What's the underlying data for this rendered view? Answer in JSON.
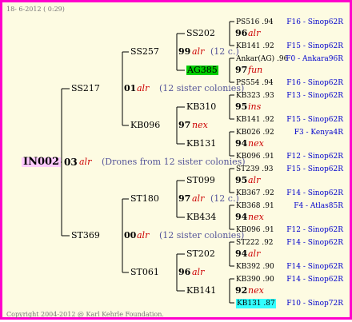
{
  "header": {
    "date": "18-  6-2012 ( 0:29)"
  },
  "footer": {
    "copyright": "Copyright 2004-2012 @ Karl Kehrle Foundation."
  },
  "root": {
    "id": "IN002",
    "num": "03",
    "mark": "alr",
    "note": "(Drones from 12 sister colonies)"
  },
  "gen1": [
    {
      "id": "SS217",
      "num": "01",
      "mark": "alr",
      "note": "(12 sister colonies)"
    },
    {
      "id": "ST369",
      "num": "00",
      "mark": "alr",
      "note": "(12 sister colonies)"
    }
  ],
  "gen2": [
    {
      "id": "SS257",
      "num": "99",
      "mark": "alr",
      "note": "(12 c.)"
    },
    {
      "id": "KB096",
      "num": "97",
      "mark": "nex"
    },
    {
      "id": "ST180",
      "num": "97",
      "mark": "alr",
      "note": "(12 c.)"
    },
    {
      "id": "ST061",
      "num": "96",
      "mark": "alr"
    }
  ],
  "gen3": [
    {
      "id": "SS202",
      "num": "96",
      "mark": "alr"
    },
    {
      "id": "AG385",
      "num": "97",
      "mark": "fun"
    },
    {
      "id": "KB310",
      "num": "95",
      "mark": "ins"
    },
    {
      "id": "KB131",
      "num": "94",
      "mark": "nex"
    },
    {
      "id": "ST099",
      "num": "95",
      "mark": "alr"
    },
    {
      "id": "KB434",
      "num": "94",
      "mark": "nex"
    },
    {
      "id": "ST202",
      "num": "94",
      "mark": "alr"
    },
    {
      "id": "KB141",
      "num": "92",
      "mark": "nex"
    }
  ],
  "gen4": [
    {
      "name": "PS516 .94",
      "origin": "F16 - Sinop62R"
    },
    {
      "name": "KB141 .92",
      "origin": "F15 - Sinop62R"
    },
    {
      "name": "Ankar(AG) .96",
      "origin": "F0 - Ankara96R"
    },
    {
      "name": "PS554 .94",
      "origin": "F16 - Sinop62R"
    },
    {
      "name": "KB323 .93",
      "origin": "F13 - Sinop62R"
    },
    {
      "name": "KB141 .92",
      "origin": "F15 - Sinop62R"
    },
    {
      "name": "KB026 .92",
      "origin": "F3 - Kenya4R"
    },
    {
      "name": "KB096 .91",
      "origin": "F12 - Sinop62R"
    },
    {
      "name": "ST239 .93",
      "origin": "F15 - Sinop62R"
    },
    {
      "name": "KB367 .92",
      "origin": "F14 - Sinop62R"
    },
    {
      "name": "KB368 .91",
      "origin": "F4 - Atlas85R"
    },
    {
      "name": "KB096 .91",
      "origin": "F12 - Sinop62R"
    },
    {
      "name": "ST222 .92",
      "origin": "F14 - Sinop62R"
    },
    {
      "name": "KB392 .90",
      "origin": "F14 - Sinop62R"
    },
    {
      "name": "KB390 .90",
      "origin": "F14 - Sinop62R"
    },
    {
      "name": "KB131 .87",
      "origin": "F10 - Sinop72R"
    }
  ],
  "colors": {
    "border": "#ff00cc",
    "background": "#fdfbe2",
    "highlight_green": "#00cc00",
    "highlight_cyan": "#33ffff",
    "origin_blue": "#0000cc",
    "mark_red": "#cc0000"
  }
}
